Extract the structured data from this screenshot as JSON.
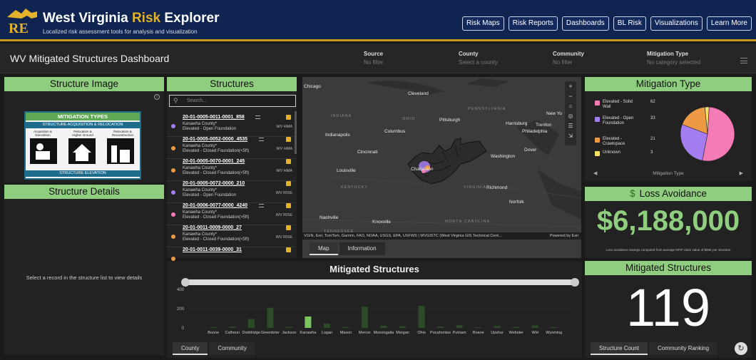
{
  "app": {
    "title_part1": "West Virginia ",
    "title_part2": "Risk",
    "title_part3": " Explorer",
    "subtitle": "Localized risk assessment tools for analysis and visualization",
    "logo_text": "RE"
  },
  "nav": [
    "Risk Maps",
    "Risk Reports",
    "Dashboards",
    "BL Risk",
    "Visualizations",
    "Learn More"
  ],
  "dashboard": {
    "title": "WV Mitigated Structures Dashboard",
    "filters": [
      {
        "label": "Source",
        "value": "No filter"
      },
      {
        "label": "County",
        "value": "Select a county"
      },
      {
        "label": "Community",
        "value": "No filter"
      },
      {
        "label": "Mitigation Type",
        "value": "No category selected"
      }
    ]
  },
  "structure_image": {
    "title": "Structure Image",
    "card_title": "MITIGATION TYPES",
    "card_sub": "STRUCTURE ACQUISITION & RELOCATION",
    "card_cols": [
      "Acquisition & Demolition",
      "Relocation & Higher Ground",
      "Relocation & Reconstruction"
    ],
    "card_footer": "STRUCTURE ELEVATION"
  },
  "structure_details": {
    "title": "Structure Details",
    "empty_text": "Select a record in the structure list to view details"
  },
  "structures": {
    "title": "Structures",
    "search_placeholder": "Search...",
    "records": [
      {
        "id": "20-01-0005-0011-0001_858",
        "county": "Kanawha County*",
        "type": "Elevated - Open Foundation",
        "source": "WV HMA",
        "color": "#a47ef0",
        "menu": true
      },
      {
        "id": "20-01-0005-0052-0000_4535",
        "county": "Kanawha County*",
        "type": "Elevated - Closed Foundation(<5ft)",
        "source": "WV HMA",
        "color": "#ee9a45",
        "menu": true
      },
      {
        "id": "20-01-0005-0070-0001_245",
        "county": "Kanawha County*",
        "type": "Elevated - Closed Foundation(<5ft)",
        "source": "WV HMA",
        "color": "#ee9a45",
        "menu": false
      },
      {
        "id": "20-01-0005-0072-0000_210",
        "county": "Kanawha County*",
        "type": "Elevated - Open Foundation",
        "source": "WV RISE",
        "color": "#a47ef0",
        "menu": false
      },
      {
        "id": "20-01-0006-0077-0000_4240",
        "county": "Kanawha County*",
        "type": "Elevated - Closed Foundation(>5ft)",
        "source": "WV RISE",
        "color": "#f47bb6",
        "menu": true
      },
      {
        "id": "20-01-0011-0009-0000_27",
        "county": "Kanawha County*",
        "type": "Elevated - Closed Foundation(<5ft)",
        "source": "WV RISE",
        "color": "#ee9a45",
        "menu": false
      },
      {
        "id": "20-01-0011-0039-0000_31",
        "county": "",
        "type": "",
        "source": "",
        "color": "#ee9a45",
        "menu": false
      }
    ]
  },
  "map": {
    "cities": [
      "Cleveland",
      "Pittsburgh",
      "Columbus",
      "Harrisburg",
      "Trenton",
      "New Yo",
      "Philadelphia",
      "Indianapolis",
      "Cincinnati",
      "Dover",
      "Washington",
      "Louisville",
      "Charleston",
      "Richmond",
      "Nashville",
      "Knoxville",
      "Norfolk",
      "Chicago"
    ],
    "regions": [
      "INDIANA",
      "OHIO",
      "PENNSYLVANIA",
      "KENTUCKY",
      "VIRGINIA",
      "TENNESSEE",
      "NORTH CAROLINA"
    ],
    "attribution": "VGIN, Esri, TomTom, Garmin, FAO, NOAA, USGS, EPA, USFWS | WVGISTC (West Virginia GIS Technical Cent...",
    "powered_by": "Powered by Esri",
    "tabs": [
      "Map",
      "Information"
    ]
  },
  "mitigation_type": {
    "title": "Mitigation Type",
    "items": [
      {
        "label": "Elevated - Solid Wall",
        "value": 62,
        "color": "#f47bb6"
      },
      {
        "label": "Elevated - Open Foundation",
        "value": 33,
        "color": "#a47ef0"
      },
      {
        "label": "Elevated - Crawlspace",
        "value": 21,
        "color": "#ee9a45"
      },
      {
        "label": "Unknown",
        "value": 3,
        "color": "#f3e266"
      }
    ],
    "caption": "Mitigation Type"
  },
  "loss_avoidance": {
    "title": "Loss Avoidance",
    "value": "$6,188,000",
    "note": "Loss avoidance savings computed from average NFIP claim value of $55K per structure"
  },
  "mitigated_count": {
    "title": "Mitigated Structures",
    "value": "119",
    "tabs": [
      "Structure Count",
      "Community Ranking"
    ]
  },
  "chart_panel": {
    "title": "Mitigated Structures",
    "tabs": [
      "County",
      "Community"
    ]
  },
  "chart_data": {
    "type": "bar",
    "categories": [
      "Boone",
      "Calhoun",
      "Doddridge",
      "Greenbrier",
      "Jackson",
      "Kanawha",
      "Logan",
      "Mason",
      "Mercer",
      "Monongalia",
      "Morgan",
      "Ohio",
      "Pocahontas",
      "Putnam",
      "Roane",
      "Upshur",
      "Webster",
      "Wirt",
      "Wyoming"
    ],
    "values": [
      8,
      14,
      93,
      210,
      12,
      119,
      45,
      10,
      220,
      22,
      18,
      230,
      15,
      28,
      7,
      20,
      12,
      25,
      9
    ],
    "highlight": "Kanawha",
    "yticks": [
      0,
      200,
      400
    ],
    "ylim": [
      0,
      430
    ]
  }
}
